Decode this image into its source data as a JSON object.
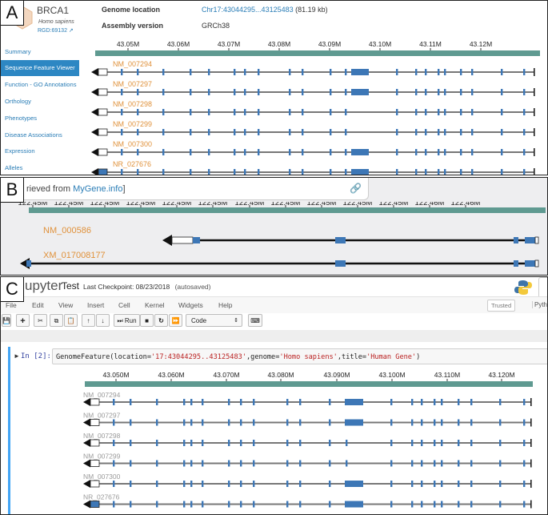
{
  "colors": {
    "axis_bar": "#5f9a91",
    "exon": "#3d77b6",
    "label_a": "#e0913a",
    "label_c": "#9a9a9a",
    "link": "#2a7db6"
  },
  "panel_a": {
    "label": "A",
    "gene": {
      "symbol": "BRCA1",
      "species": "Homo sapiens",
      "rgd": "RGD:69132"
    },
    "sidebar": [
      "Summary",
      "Sequence Feature Viewer",
      "Function - GO Annotations",
      "Orthology",
      "Phenotypes",
      "Disease Associations",
      "Expression",
      "Alleles"
    ],
    "info": {
      "loc_label": "Genome location",
      "loc_value": "Chr17:43044295...43125483",
      "loc_size": "(81.19 kb)",
      "asm_label": "Assembly version",
      "asm_value": "GRCh38"
    },
    "ticks": [
      "43.05M",
      "43.06M",
      "43.07M",
      "43.08M",
      "43.09M",
      "43.10M",
      "43.11M",
      "43.12M"
    ],
    "tracks": [
      "NM_007294",
      "NM_007297",
      "NM_007298",
      "NM_007299",
      "NM_007300",
      "NR_027676"
    ]
  },
  "panel_b": {
    "label": "B",
    "retrieved_prefix": "rieved from ",
    "retrieved_link": "MyGene.info",
    "retrieved_suffix": "]",
    "ticks": [
      "122.45M",
      "122.45M",
      "122.45M",
      "122.45M",
      "122.45M",
      "122.45M",
      "122.45M",
      "122.45M",
      "122.45M",
      "122.45M",
      "122.45M",
      "122.46M",
      "122.46M"
    ],
    "tracks": [
      "NM_000586",
      "XM_017008177"
    ]
  },
  "panel_c": {
    "label": "C",
    "app": "upyter",
    "notebook": "Test",
    "checkpoint": "Last Checkpoint: 08/23/2018",
    "autosaved": "(autosaved)",
    "menu": [
      "File",
      "Edit",
      "View",
      "Insert",
      "Cell",
      "Kernel",
      "Widgets",
      "Help"
    ],
    "trusted": "Trusted",
    "kernel": "Pyth",
    "run_label": "Run",
    "cell_type": "Code",
    "prompt": "In [2]:",
    "code": {
      "fn": "GenomeFeature(location=",
      "loc": "'17:43044295..43125483'",
      "g_kw": ",genome=",
      "genome": "'Homo sapiens'",
      "t_kw": ",title=",
      "title": "'Human Gene'",
      "end": ")"
    },
    "ticks": [
      "43.050M",
      "43.060M",
      "43.070M",
      "43.080M",
      "43.090M",
      "43.100M",
      "43.110M",
      "43.120M"
    ],
    "tracks": [
      "NM_007294",
      "NM_007297",
      "NM_007298",
      "NM_007299",
      "NM_007300",
      "NR_027676"
    ]
  }
}
